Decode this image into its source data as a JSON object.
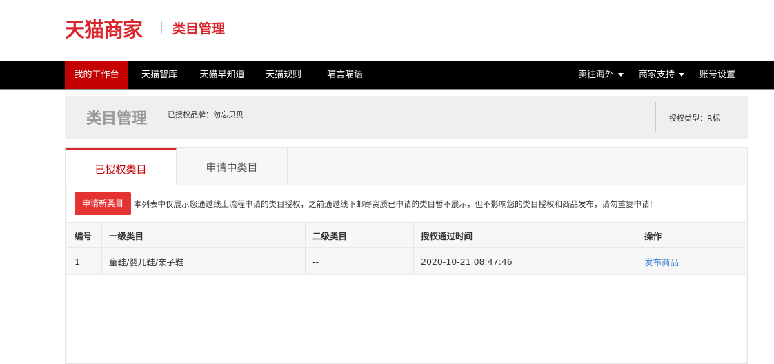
{
  "header": {
    "logo_text": "天猫商家",
    "subtitle": "类目管理"
  },
  "nav": {
    "items": [
      "我的工作台",
      "天猫智库",
      "天猫早知道",
      "天猫规则",
      "喵言喵语"
    ],
    "right_items": [
      "卖往海外",
      "商家支持",
      "账号设置"
    ]
  },
  "page": {
    "title": "类目管理",
    "brand": "已授权品牌：勿忘贝贝",
    "auth_type": "授权类型：R标"
  },
  "tabs": [
    "已授权类目",
    "申请中类目"
  ],
  "toolbar": {
    "apply_label": "申请新类目",
    "notice": "本列表中仅展示您通过线上流程申请的类目授权，之前通过线下邮寄资质已申请的类目暂不展示，但不影响您的类目授权和商品发布，请勿重复申请!"
  },
  "table": {
    "headers": [
      "编号",
      "一级类目",
      "二级类目",
      "授权通过时间",
      "操作"
    ],
    "rows": [
      [
        "1",
        "童鞋/婴儿鞋/亲子鞋",
        "--",
        "2020-10-21 08:47:46",
        "发布商品"
      ]
    ]
  },
  "colors": {
    "brand_red": "#d9262c",
    "nav_active": "#c40000",
    "link": "#3a7ccf"
  }
}
